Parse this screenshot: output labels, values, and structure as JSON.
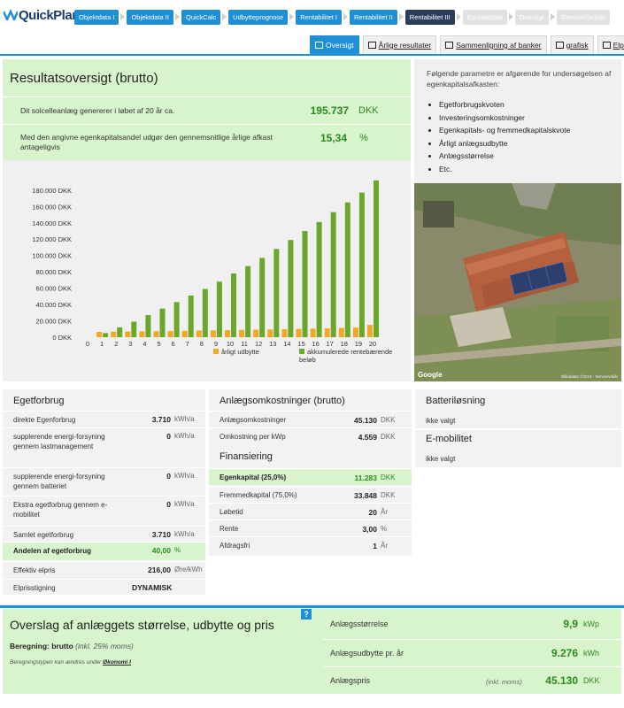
{
  "app": {
    "logo_text": "QuickPlan"
  },
  "steps": [
    {
      "label": "Objektdata I",
      "state": "done"
    },
    {
      "label": "Objektdata II",
      "state": "done"
    },
    {
      "label": "QuickCalc",
      "state": "done"
    },
    {
      "label": "Udbytteprognose",
      "state": "done"
    },
    {
      "label": "Rentabilitet I",
      "state": "done"
    },
    {
      "label": "Rentabilitet II",
      "state": "done"
    },
    {
      "label": "Rentabilitet III",
      "state": "active"
    },
    {
      "label": "Kontaktdata",
      "state": "disabled"
    },
    {
      "label": "Oversigt",
      "state": "disabled"
    },
    {
      "label": "Gemme/Sende",
      "state": "disabled"
    }
  ],
  "tabs": [
    {
      "label": "Oversigt",
      "active": true
    },
    {
      "label": "Årlige resultater",
      "active": false
    },
    {
      "label": "Sammenligning af banker",
      "active": false
    },
    {
      "label": "grafisk",
      "active": false
    },
    {
      "label": "Elpris",
      "active": false
    }
  ],
  "summary": {
    "title": "Resultatsoversigt (brutto)",
    "row1_label": "Dit solcelleanlæg genererer i løbet af 20 år ca.",
    "row1_value": "195.737",
    "row1_unit": "DKK",
    "row2_label": "Med den angivne egenkapitalsandel udgør den gennemsnitlige årlige afkast antageligvis",
    "row2_value": "15,34",
    "row2_unit": "%"
  },
  "info": {
    "intro": "Følgende parametre er afgørende for undersøgelsen af egenkapitalsafkasten:",
    "items": [
      "Egetforbrugskvoten",
      "Investeringsomkostninger",
      "Egenkapitals- og fremmedkapitalskvote",
      "Årligt anlægsudbytte",
      "Anlægsstørrelse",
      "Etc."
    ]
  },
  "photo": {
    "google_label": "Google",
    "credit": "Billeddata ©2019 · Servicevilkår"
  },
  "chart_data": {
    "type": "bar",
    "categories": [
      "0",
      "1",
      "2",
      "3",
      "4",
      "5",
      "6",
      "7",
      "8",
      "9",
      "10",
      "11",
      "12",
      "13",
      "14",
      "15",
      "16",
      "17",
      "18",
      "19",
      "20"
    ],
    "ytick_labels": [
      "0 DKK",
      "20.000 DKK",
      "40.000 DKK",
      "60.000 DKK",
      "80.000 DKK",
      "100.000 DKK",
      "120.000 DKK",
      "140.000 DKK",
      "160.000 DKK",
      "180.000 DKK"
    ],
    "ylim": [
      0,
      195000
    ],
    "series": [
      {
        "name": "årligt udbytte",
        "color": "#f5a623",
        "values": [
          0,
          6500,
          6700,
          6900,
          7100,
          7300,
          7600,
          7800,
          8100,
          8300,
          8600,
          8900,
          9200,
          9500,
          9800,
          10100,
          10500,
          10900,
          11300,
          11800,
          15000
        ]
      },
      {
        "name": "akkumulerede renteбærende beløb",
        "color": "#6aa829",
        "values": [
          0,
          5000,
          12000,
          19000,
          27000,
          35000,
          43000,
          51000,
          59000,
          68000,
          78000,
          87000,
          97000,
          108000,
          119000,
          130000,
          141000,
          153000,
          165000,
          177000,
          192000
        ]
      }
    ]
  },
  "own_consumption": {
    "title": "Egetforbrug",
    "rows": [
      {
        "label": "direkte Egenforbrug",
        "value": "3.710",
        "unit": "kWh/a"
      },
      {
        "label": "supplerende energi-forsyning gennem lastmanagement",
        "value": "0",
        "unit": "kWh/a"
      },
      {
        "label": "supplerende energi-forsyning gennem batteriet",
        "value": "0",
        "unit": "kWh/a"
      },
      {
        "label": "Ekstra egetforbrug gennem e-mobilitet",
        "value": "0",
        "unit": "kWh/a"
      },
      {
        "label": "Samlet egetforbrug",
        "value": "3.710",
        "unit": "kWh/a"
      },
      {
        "label": "Andelen af egetforbrug",
        "value": "40,00",
        "unit": "%"
      },
      {
        "label": "Effektiv elpris",
        "value": "216,00",
        "unit": "Øre/kWh"
      },
      {
        "label": "Elprisstigning",
        "value": "DYNAMISK",
        "unit": ""
      }
    ]
  },
  "costs": {
    "title": "Anlægsomkostninger (brutto)",
    "rows": [
      {
        "label": "Anlægsomkostninger",
        "value": "45.130",
        "unit": "DKK"
      },
      {
        "label": "Omkostning per kWp",
        "value": "4.559",
        "unit": "DKK"
      }
    ],
    "fin_title": "Finansiering",
    "fin_rows": [
      {
        "label": "Egenkapital (25,0%)",
        "value": "11.283",
        "unit": "DKK"
      },
      {
        "label": "Fremmedkapital (75,0%)",
        "value": "33.848",
        "unit": "DKK"
      },
      {
        "label": "Løbetid",
        "value": "20",
        "unit": "År"
      },
      {
        "label": "Rente",
        "value": "3,00",
        "unit": "%"
      },
      {
        "label": "Afdragsfri",
        "value": "1",
        "unit": "År"
      }
    ]
  },
  "battery": {
    "title": "Batteriløsning",
    "value": "ikke valgt"
  },
  "emobility": {
    "title": "E-mobilitet",
    "value": "ikke valgt"
  },
  "estimate": {
    "title": "Overslag af anlæggets størrelse, udbytte og pris",
    "calc_label": "Beregning: brutto",
    "calc_note": "(inkl. 25% moms)",
    "change_text": "Beregningstypen kan ændres under",
    "change_link": "Økonomi I",
    "help": "?",
    "rows": [
      {
        "label": "Anlægsstørrelse",
        "note": "",
        "value": "9,9",
        "unit": "kWp"
      },
      {
        "label": "Anlægsudbytte pr. år",
        "note": "",
        "value": "9.276",
        "unit": "kWh"
      },
      {
        "label": "Anlægspris",
        "note": "(inkl. moms)",
        "value": "45.130",
        "unit": "DKK"
      }
    ]
  }
}
